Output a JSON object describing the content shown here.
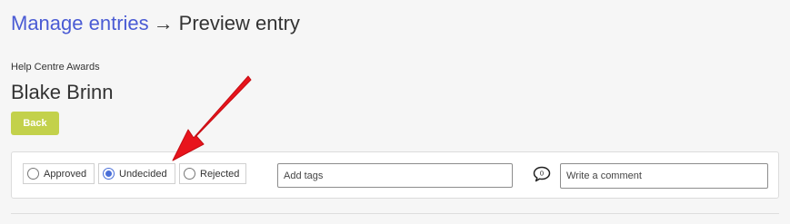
{
  "breadcrumb": {
    "parent": "Manage entries",
    "separator": "→",
    "current": "Preview entry"
  },
  "entry": {
    "program": "Help Centre Awards",
    "name": "Blake Brinn"
  },
  "back_button": {
    "label": "Back"
  },
  "review": {
    "statuses": [
      {
        "label": "Approved",
        "selected": false
      },
      {
        "label": "Undecided",
        "selected": true
      },
      {
        "label": "Rejected",
        "selected": false
      }
    ],
    "tags_placeholder": "Add tags",
    "comment_count": "0",
    "comment_placeholder": "Write a comment"
  },
  "colors": {
    "link": "#4a5bd4",
    "back_button": "#c3d14b",
    "radio_selected": "#4a6fd8",
    "annotation_arrow": "#e8141c"
  },
  "icons": {
    "comment": "speech-bubble-icon",
    "annotation": "red-arrow-annotation"
  }
}
